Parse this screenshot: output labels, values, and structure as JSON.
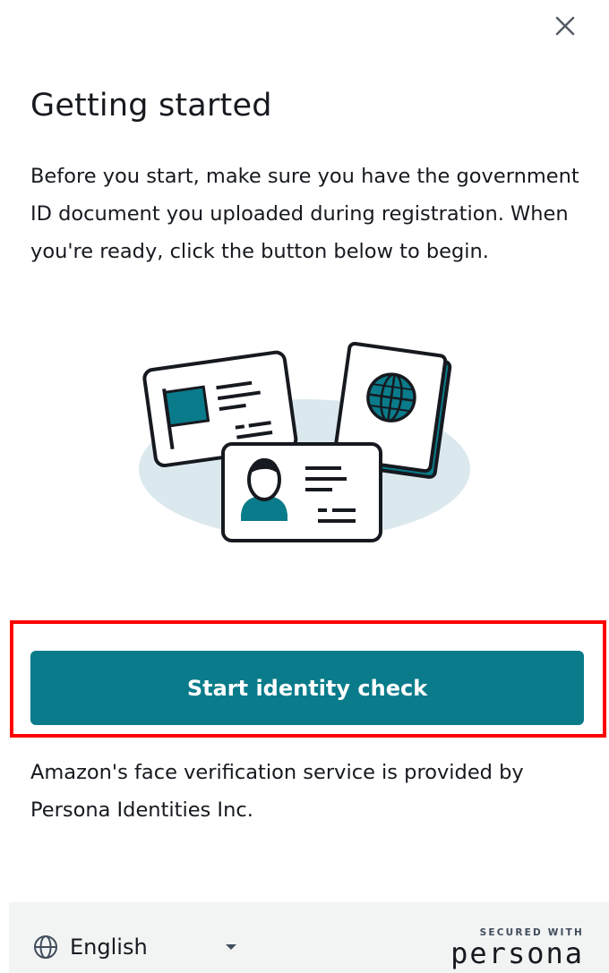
{
  "header": {
    "close_icon": "close-icon"
  },
  "content": {
    "title": "Getting started",
    "intro": "Before you start, make sure you have the government ID document you uploaded during registration. When you're ready, click the button below to begin.",
    "illustration": "id-documents-illustration",
    "primary_button_label": "Start identity check",
    "provider_note": "Amazon's face verification service is provided by Persona Identities Inc."
  },
  "footer": {
    "language_icon": "globe-icon",
    "language_label": "English",
    "caret_icon": "caret-down-icon",
    "secured_with": "SECURED WITH",
    "brand": "persona"
  },
  "colors": {
    "accent": "#0a7b8a",
    "highlight": "#ff0000",
    "footer_bg": "#f2f3f3",
    "illustration_bg": "#dbe9ee"
  }
}
